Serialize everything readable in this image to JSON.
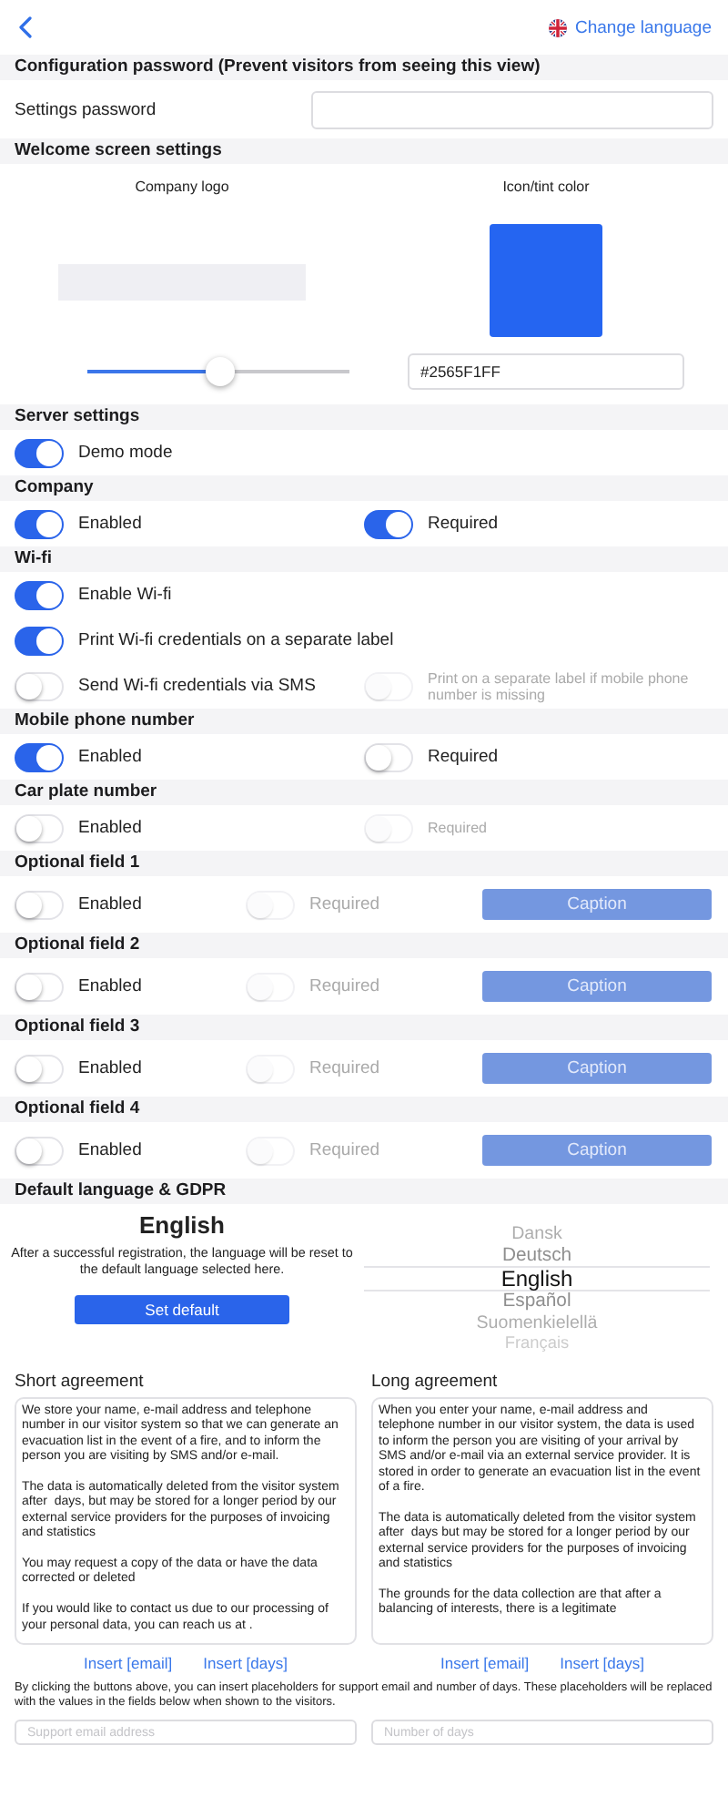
{
  "top_bar": {
    "change_language": "Change language"
  },
  "sections": [
    {
      "title": "Configuration password (Prevent visitors from seeing this view)",
      "kind": "password",
      "label": "Settings password"
    },
    {
      "title": "Welcome screen settings",
      "kind": "welcome",
      "logo_label": "Company logo",
      "logo_size": {
        "level": 0.51
      },
      "tint_label": "Icon/tint color",
      "tint_value": "#2565F1FF"
    },
    {
      "title": "Server settings",
      "kind": "toggles",
      "rows": [
        [
          {
            "label": "Demo mode",
            "on": true,
            "disabled": false
          }
        ]
      ]
    },
    {
      "title": "Company",
      "kind": "toggles",
      "rows": [
        [
          {
            "label": "Enabled",
            "on": true,
            "disabled": false
          },
          {
            "label": "Required",
            "on": true,
            "disabled": false
          }
        ]
      ]
    },
    {
      "title": "Wi-fi",
      "kind": "toggles",
      "rows": [
        [
          {
            "label": "Enable Wi-fi",
            "on": true,
            "disabled": false
          }
        ],
        [
          {
            "label": "Print Wi-fi credentials on a separate label",
            "on": true,
            "disabled": false
          }
        ],
        [
          {
            "label": "Send Wi-fi credentials via SMS",
            "on": false,
            "disabled": false
          },
          {
            "label": "Print on a separate label if mobile phone number is missing",
            "on": false,
            "disabled": true
          }
        ]
      ]
    },
    {
      "title": "Mobile phone number",
      "kind": "toggles",
      "rows": [
        [
          {
            "label": "Enabled",
            "on": true,
            "disabled": false
          },
          {
            "label": "Required",
            "on": false,
            "disabled": false
          }
        ]
      ]
    },
    {
      "title": "Car plate number",
      "kind": "toggles",
      "rows": [
        [
          {
            "label": "Enabled",
            "on": false,
            "disabled": false
          },
          {
            "label": "Required",
            "on": false,
            "disabled": true
          }
        ]
      ]
    },
    {
      "title": "Optional field 1",
      "kind": "optional",
      "enabled": {
        "label": "Enabled",
        "on": false,
        "disabled": false
      },
      "required": {
        "label": "Required",
        "on": false,
        "disabled": true
      },
      "caption": {
        "label": "Caption",
        "disabled": true
      }
    },
    {
      "title": "Optional field 2",
      "kind": "optional",
      "enabled": {
        "label": "Enabled",
        "on": false,
        "disabled": false
      },
      "required": {
        "label": "Required",
        "on": false,
        "disabled": true
      },
      "caption": {
        "label": "Caption",
        "disabled": true
      }
    },
    {
      "title": "Optional field 3",
      "kind": "optional",
      "enabled": {
        "label": "Enabled",
        "on": false,
        "disabled": false
      },
      "required": {
        "label": "Required",
        "on": false,
        "disabled": true
      },
      "caption": {
        "label": "Caption",
        "disabled": true
      }
    },
    {
      "title": "Optional field 4",
      "kind": "optional",
      "enabled": {
        "label": "Enabled",
        "on": false,
        "disabled": false
      },
      "required": {
        "label": "Required",
        "on": false,
        "disabled": true
      },
      "caption": {
        "label": "Caption",
        "disabled": true
      }
    },
    {
      "title": "Default language & GDPR",
      "kind": "language",
      "current": "English",
      "note": "After a successful registration, the language will be reset to the default language selected here.",
      "button": "Set default",
      "languages": [
        {
          "label": "Dansk",
          "selected": false
        },
        {
          "label": "Deutsch",
          "selected": false
        },
        {
          "label": "English",
          "selected": true
        },
        {
          "label": "Español",
          "selected": false
        },
        {
          "label": "Suomenkielellä",
          "selected": false
        },
        {
          "label": "Français",
          "selected": false
        }
      ]
    }
  ],
  "agreements": [
    {
      "title": "Short agreement",
      "text": "We store your name, e-mail address and telephone number in our visitor system so that we can generate an evacuation list in the event of a fire, and to inform the person you are visiting by SMS and/or e-mail.\n\nThe data is automatically deleted from the visitor system after  days, but may be stored for a longer period by our external service providers for the purposes of invoicing and statistics\n\nYou may request a copy of the data or have the data corrected or deleted\n\nIf you would like to contact us due to our processing of your personal data, you can reach us at .",
      "buttons": [
        "Insert [email]",
        "Insert [days]"
      ]
    },
    {
      "title": "Long agreement",
      "text": "When you enter your name, e-mail address and telephone number in our visitor system, the data is used to inform the person you are visiting of your arrival by SMS and/or e-mail via an external service provider. It is stored in order to generate an evacuation list in the event of a fire.\n\nThe data is automatically deleted from the visitor system after  days but may be stored for a longer period by our external service providers for the purposes of invoicing and statistics\n\nThe grounds for the data collection are that after a balancing of interests, there is a legitimate",
      "buttons": [
        "Insert [email]",
        "Insert [days]"
      ]
    }
  ],
  "placeholder_note": "By clicking the buttons above, you can insert placeholders for support email and number of days. These placeholders will be replaced with the values in the fields below when shown to the visitors.",
  "fields": [
    {
      "placeholder": "Support email address"
    },
    {
      "placeholder": "Number of days"
    }
  ]
}
